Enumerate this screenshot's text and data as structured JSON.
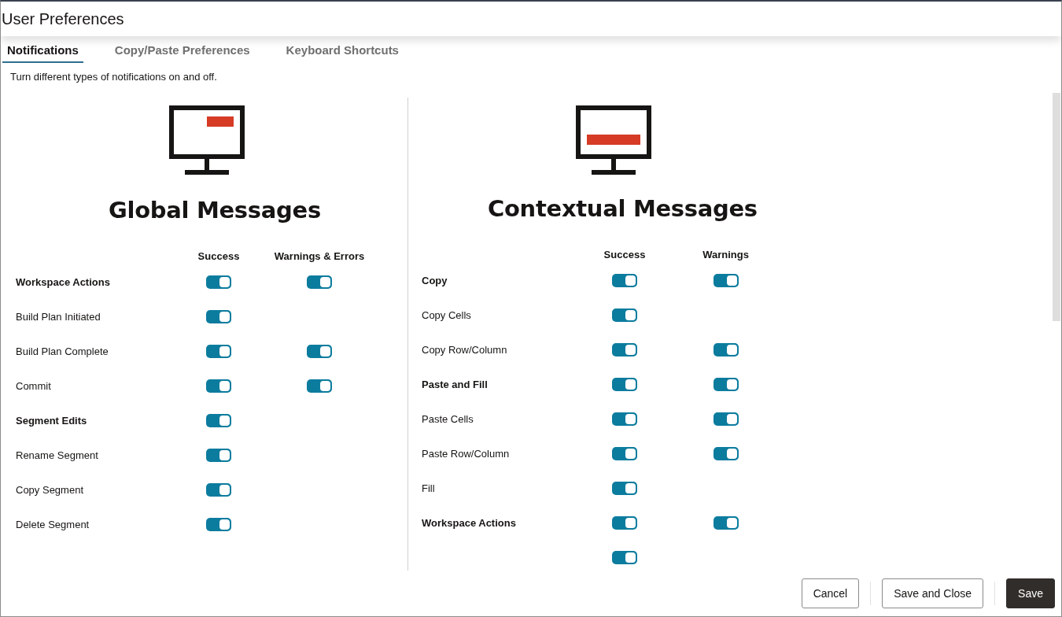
{
  "window": {
    "title": "User Preferences"
  },
  "tabs": [
    {
      "label": "Notifications",
      "selected": true
    },
    {
      "label": "Copy/Paste Preferences",
      "selected": false
    },
    {
      "label": "Keyboard Shortcuts",
      "selected": false
    }
  ],
  "description": "Turn different types of notifications on and off.",
  "panels": [
    {
      "kind": "banner",
      "heading": "Global Messages",
      "columns": [
        "Success",
        "Warnings & Errors"
      ],
      "rows": [
        {
          "kind": "group",
          "label": "Workspace Actions",
          "success_on": true,
          "warnings_on": true
        },
        {
          "kind": "item",
          "label": "Build Plan Initiated",
          "success_on": true
        },
        {
          "kind": "item",
          "label": "Build Plan Complete",
          "success_on": true,
          "warnings_on": true
        },
        {
          "kind": "item",
          "label": "Commit",
          "success_on": true,
          "warnings_on": true
        },
        {
          "kind": "group",
          "label": "Segment Edits",
          "success_on": true
        },
        {
          "kind": "item",
          "label": "Rename Segment",
          "success_on": true
        },
        {
          "kind": "item",
          "label": "Copy Segment",
          "success_on": true
        },
        {
          "kind": "item",
          "label": "Delete Segment",
          "success_on": true
        }
      ]
    },
    {
      "kind": "inline",
      "heading": "Contextual Messages",
      "columns": [
        "Success",
        "Warnings"
      ],
      "rows": [
        {
          "kind": "group",
          "label": "Copy",
          "success_on": true,
          "warnings_on": true
        },
        {
          "kind": "item",
          "label": "Copy Cells",
          "success_on": true
        },
        {
          "kind": "item",
          "label": "Copy Row/Column",
          "success_on": true,
          "warnings_on": true
        },
        {
          "kind": "group",
          "label": "Paste and Fill",
          "success_on": true,
          "warnings_on": true
        },
        {
          "kind": "item",
          "label": "Paste Cells",
          "success_on": true,
          "warnings_on": true
        },
        {
          "kind": "item",
          "label": "Paste Row/Column",
          "success_on": true,
          "warnings_on": true
        },
        {
          "kind": "item",
          "label": "Fill",
          "success_on": true
        },
        {
          "kind": "group",
          "label": "Workspace Actions",
          "success_on": true,
          "warnings_on": true
        },
        {
          "kind": "partial",
          "success_on": true
        }
      ]
    }
  ],
  "buttons": [
    {
      "label": "Cancel",
      "kind": "secondary"
    },
    {
      "label": "Save and Close",
      "kind": "secondary"
    },
    {
      "label": "Save",
      "kind": "primary"
    }
  ]
}
